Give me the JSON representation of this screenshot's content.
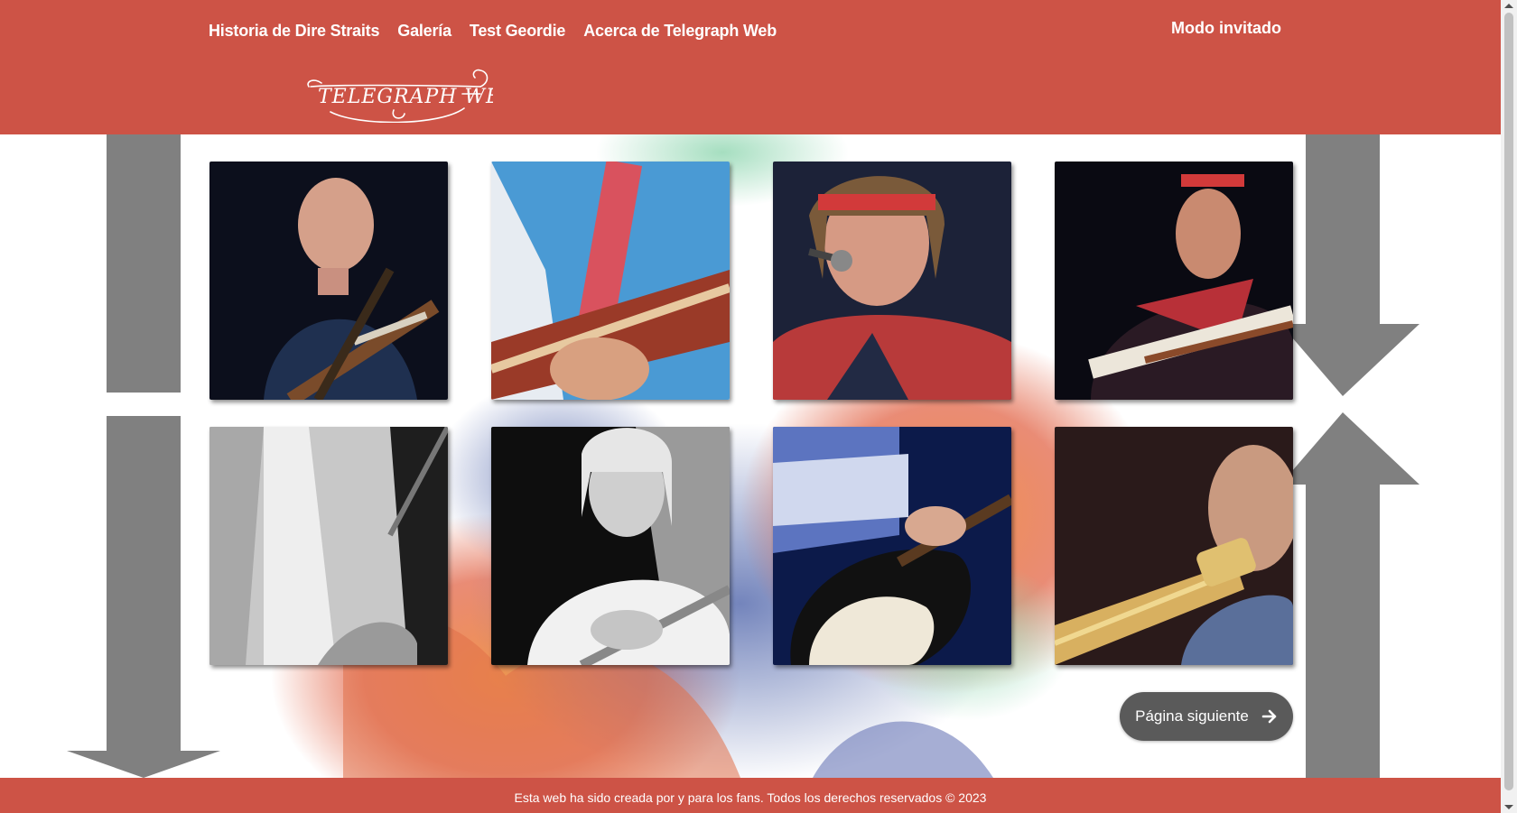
{
  "nav": {
    "items": [
      {
        "label": "Historia de Dire Straits"
      },
      {
        "label": "Galería"
      },
      {
        "label": "Test Geordie"
      },
      {
        "label": "Acerca de Telegraph Web"
      }
    ],
    "guest_label": "Modo invitado"
  },
  "logo": {
    "text": "TELEGRAPH WEB"
  },
  "gallery": {
    "photos": [
      {
        "icon": "guitarist-photo"
      },
      {
        "icon": "guitarist-photo"
      },
      {
        "icon": "guitarist-photo"
      },
      {
        "icon": "guitarist-photo"
      },
      {
        "icon": "guitarist-photo"
      },
      {
        "icon": "guitarist-photo"
      },
      {
        "icon": "guitarist-photo"
      },
      {
        "icon": "guitarist-photo"
      }
    ]
  },
  "pagination": {
    "next_label": "Página siguiente"
  },
  "footer": {
    "text": "Esta web ha sido creada por y para los fans. Todos los derechos reservados © 2023"
  },
  "colors": {
    "header": "#cd5346",
    "button": "#5a5a5a",
    "arrows": "#808080"
  }
}
